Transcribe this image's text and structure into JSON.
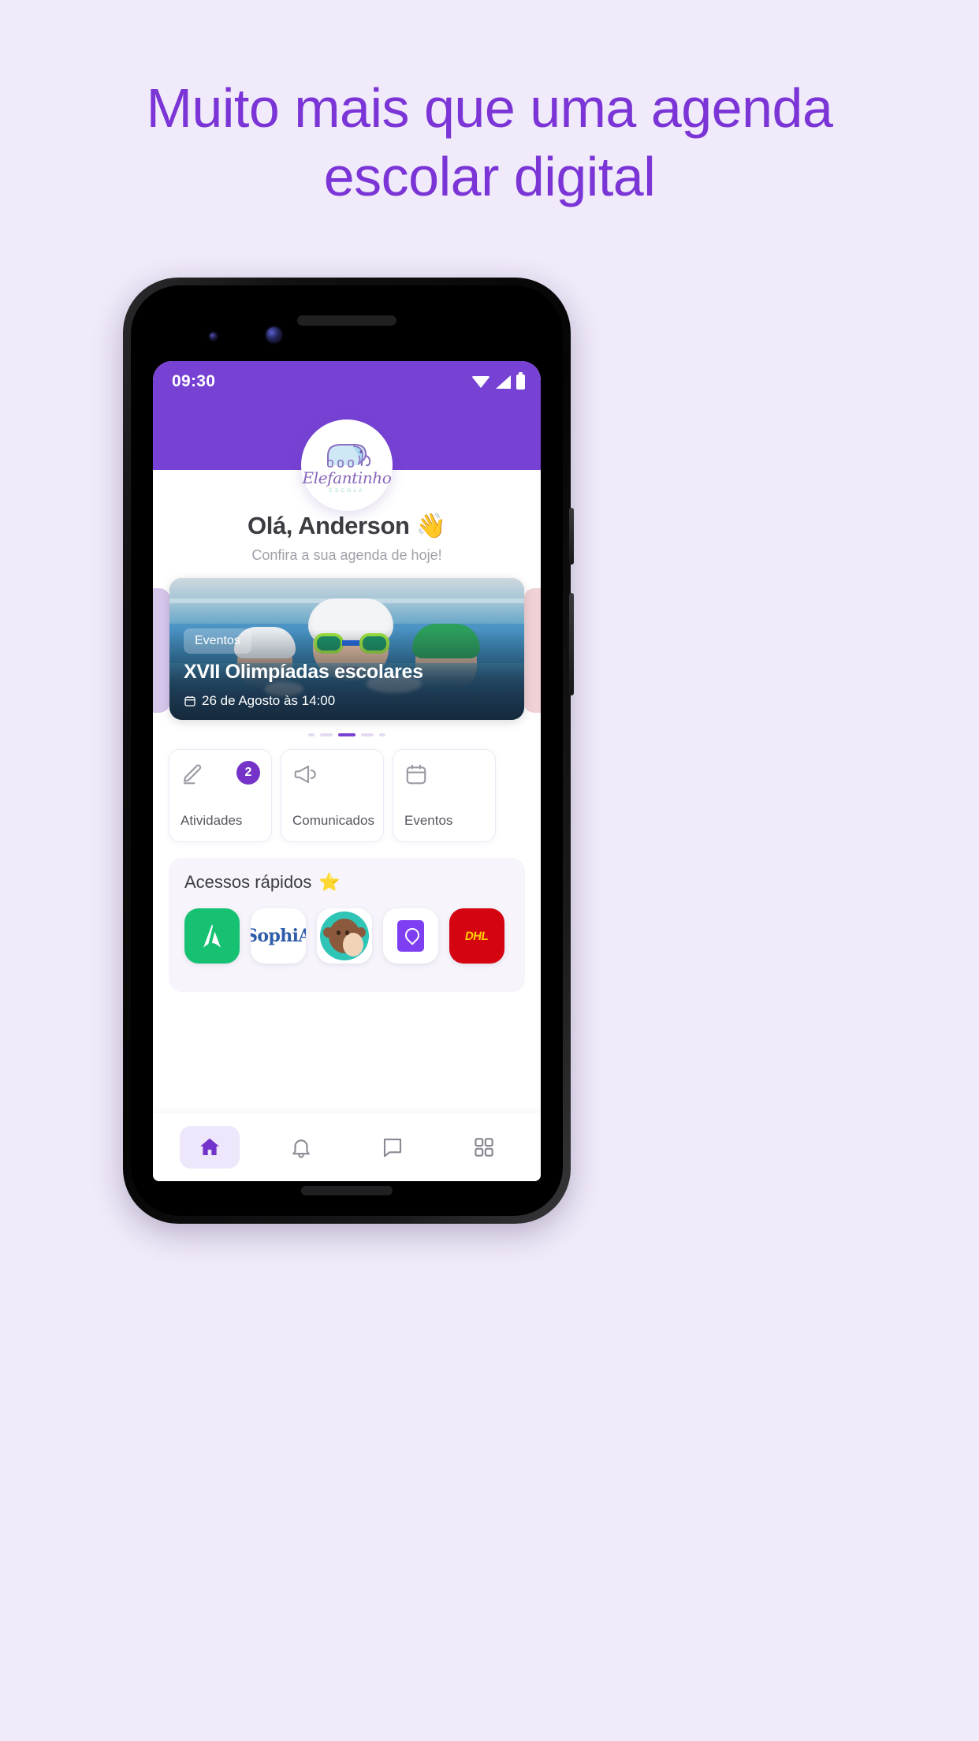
{
  "hero": {
    "headline_line1": "Muito mais que uma agenda",
    "headline_line2": "escolar digital",
    "headline_color": "#7b35d6",
    "background_color": "#f0eafa"
  },
  "phone": {
    "statusbar": {
      "time": "09:30",
      "icons": [
        "wifi-icon",
        "signal-icon",
        "battery-icon"
      ],
      "background_color": "#7742d4"
    },
    "logo": {
      "name": "Elefantinho",
      "subtitle": "ESCOLA",
      "icon": "elephant-icon"
    },
    "greeting": {
      "title": "Olá, Anderson 👋",
      "subtitle": "Confira a sua agenda de hoje!"
    },
    "carousel": {
      "slide": {
        "category": "Eventos",
        "title": "XVII Olimpíadas escolares",
        "date": "26 de Agosto às 14:00",
        "date_icon": "calendar-icon",
        "image_alt": "swimming-pool-children"
      },
      "dots": [
        {
          "active": false,
          "tiny": true
        },
        {
          "active": false,
          "tiny": false
        },
        {
          "active": true,
          "tiny": false
        },
        {
          "active": false,
          "tiny": false
        },
        {
          "active": false,
          "tiny": true
        }
      ]
    },
    "tiles": [
      {
        "label": "Atividades",
        "icon": "pencil-icon",
        "badge": "2"
      },
      {
        "label": "Comunicados",
        "icon": "megaphone-icon",
        "badge": ""
      },
      {
        "label": "Eventos",
        "icon": "calendar-icon",
        "badge": ""
      }
    ],
    "quick_access": {
      "title": "Acessos rápidos",
      "title_icon": "star-icon",
      "apps": [
        {
          "name": "arbo-app-icon",
          "label": ""
        },
        {
          "name": "sophia-app-icon",
          "label": "SophiA"
        },
        {
          "name": "monkey-app-icon",
          "label": ""
        },
        {
          "name": "book-app-icon",
          "label": ""
        },
        {
          "name": "dhl-app-icon",
          "label": "DHL"
        }
      ]
    },
    "bottom_nav": [
      {
        "name": "home",
        "icon": "home-icon",
        "active": true
      },
      {
        "name": "notifications",
        "icon": "bell-icon",
        "active": false
      },
      {
        "name": "messages",
        "icon": "chat-icon",
        "active": false
      },
      {
        "name": "more",
        "icon": "grid-icon",
        "active": false
      }
    ]
  }
}
